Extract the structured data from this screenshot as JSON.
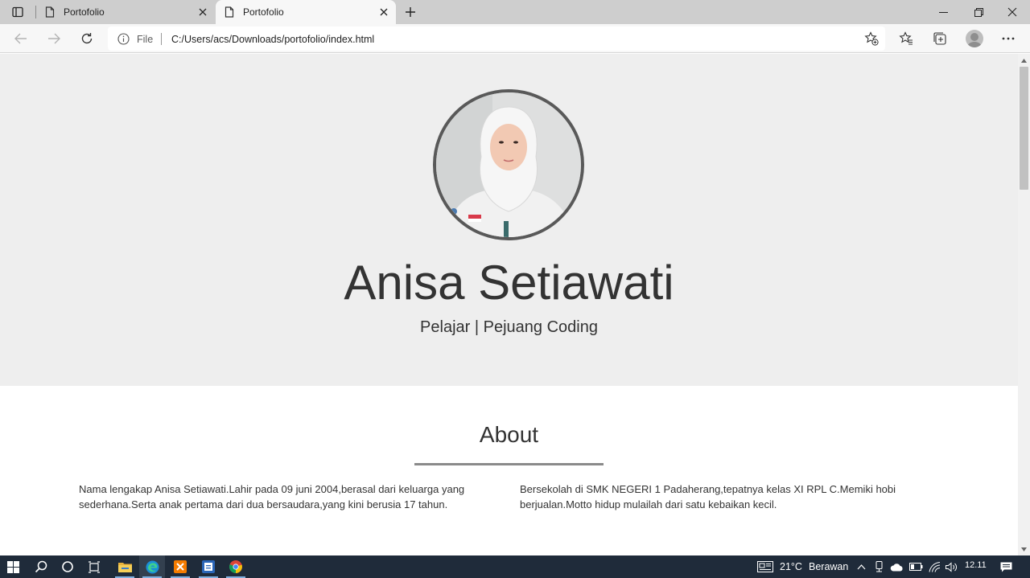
{
  "browser": {
    "tabs": [
      {
        "title": "Portofolio",
        "active": false
      },
      {
        "title": "Portofolio",
        "active": true
      }
    ],
    "address": {
      "scheme_label": "File",
      "url": "C:/Users/acs/Downloads/portofolio/index.html"
    },
    "icons": {
      "tab_actions": "tab-actions-icon",
      "page": "page-icon",
      "close": "close-icon",
      "new_tab": "plus-icon",
      "back": "arrow-left-icon",
      "forward": "arrow-right-icon",
      "refresh": "refresh-icon",
      "info": "info-icon",
      "add_favorite": "star-add-icon",
      "favorites": "favorites-icon",
      "collections": "collections-icon",
      "profile": "avatar",
      "more": "more-icon"
    }
  },
  "page": {
    "hero": {
      "name": "Anisa Setiawati",
      "tagline": "Pelajar | Pejuang Coding"
    },
    "about": {
      "title": "About",
      "left_text": "Nama lengakap Anisa Setiawati.Lahir pada 09 juni 2004,berasal dari keluarga yang sederhana.Serta anak pertama dari dua bersaudara,yang kini berusia 17 tahun.",
      "right_text": "Bersekolah di SMK NEGERI 1 Padaherang,tepatnya kelas XI RPL C.Memiki hobi berjualan.Motto hidup mulailah dari satu kebaikan kecil."
    }
  },
  "taskbar": {
    "weather": {
      "temp": "21°C",
      "condition": "Berawan"
    },
    "clock": "12.11"
  },
  "colors": {
    "hero_bg": "#eeeeee",
    "text": "#333333",
    "taskbar": "#1f2b3a"
  }
}
